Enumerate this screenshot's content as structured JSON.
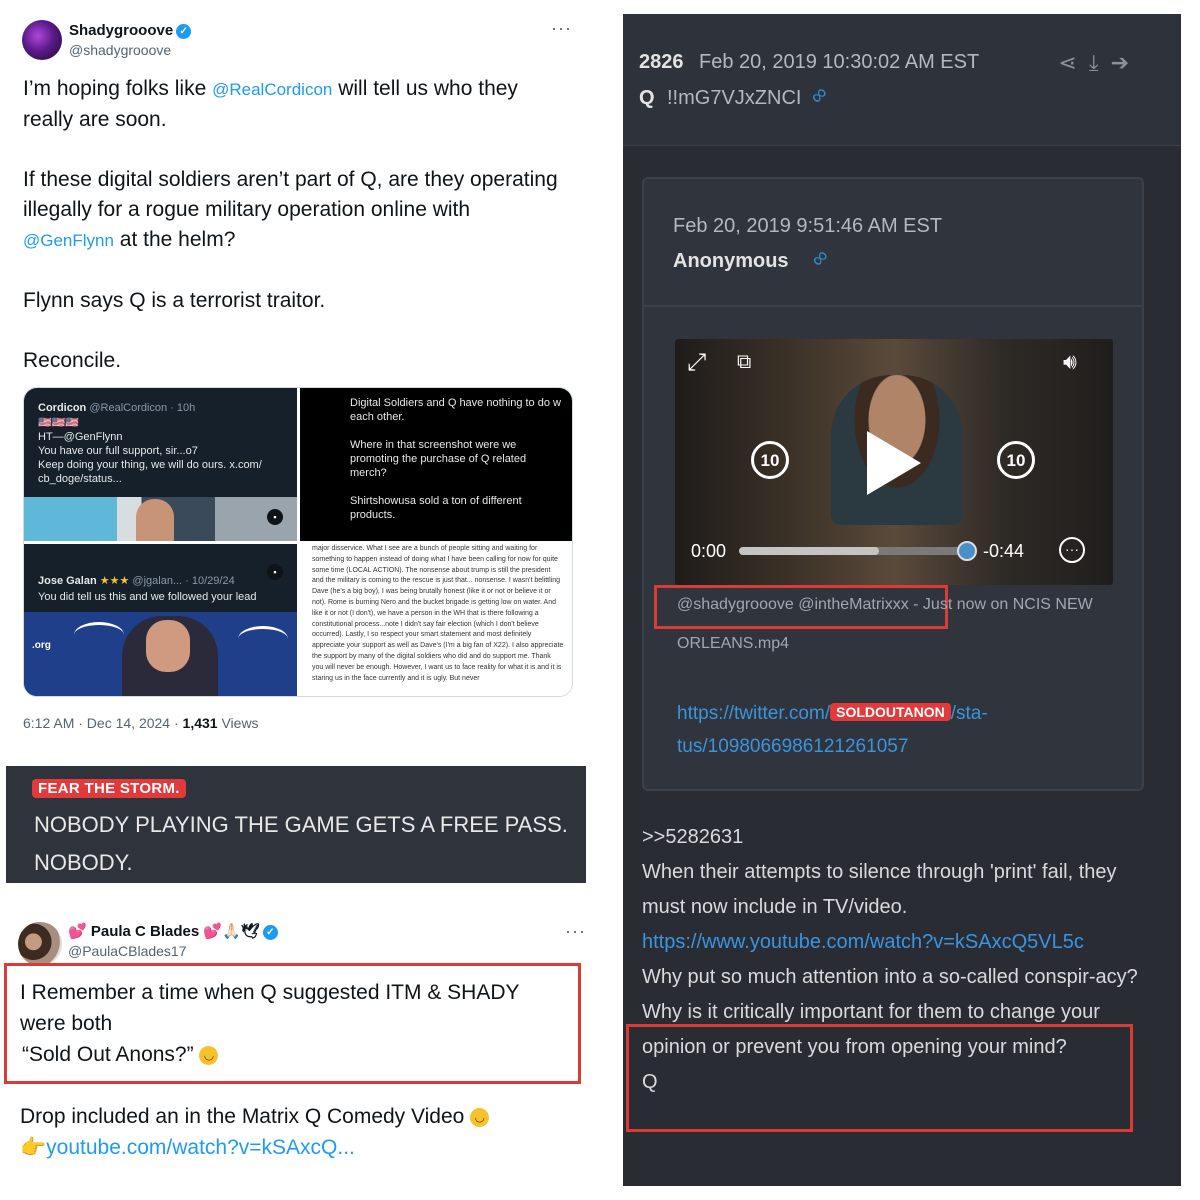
{
  "tweet1": {
    "name": "Shadygrooove",
    "handle": "@shadygrooove",
    "more": "···",
    "p1_pre": "I’m hoping folks like ",
    "p1_mention": "@RealCordicon",
    "p1_post": " will tell us who they really are soon.",
    "p2_pre": "If these digital soldiers aren’t part of Q, are they operating illegally for a rogue military operation online with ",
    "p2_mention": "@GenFlynn",
    "p2_post": " at the helm?",
    "p3": "Flynn says Q is a terrorist traitor.",
    "p4": "Reconcile.",
    "time": "6:12 AM · Dec 14, 2024 · ",
    "views_count": "1,431",
    "views_label": " Views",
    "media": {
      "tl_name": "Cordicon",
      "tl_handle": "@RealCordicon · 10h",
      "tl_flags": "🇺🇸🇺🇸🇺🇸",
      "tl_line1": "HT—@GenFlynn",
      "tl_line2": "You have our full support, sir...o7",
      "tl_line3": "Keep doing your thing, we will do ours. x.com/",
      "tl_line4": "cb_doge/status...",
      "tr_line1": "Digital Soldiers and Q have nothing to do w each other.",
      "tr_line2": "Where in that screenshot were we promoting the purchase of Q related merch?",
      "tr_line3": "Shirtshowusa sold a ton of different products.",
      "bl_name": "Jose Galan",
      "bl_stars": "★★★",
      "bl_handle": "@jgalan... · 10/29/24",
      "bl_line": "You did tell us this and we followed your lead",
      "bl_logo": ".org",
      "br_text": "major disservice. What I see are a bunch of people sitting and waiting for something to happen instead of doing what I have been calling for now for quite some time (LOCAL ACTION). The nonsense about trump is still the president and the military is coming to the rescue is just that... nonsense. I wasn't belittling Dave (he's a big boy), I was being brutally honest (like it or not or believe it or not). Rome is burning Nero and the bucket brigade is getting low on water. And like it or not (I don't), we have a person in the WH that is there following a constitutional process...note I didn't say fair election (which I don't believe occurred). Lastly, I so respect your smart statement and most definitely appreciate your support as well as Dave's (I'm a big fan of X22). I also appreciate the support by many of the digital soldiers who did and do support me. Thank you will never be enough. However, I want us to face reality for what it is and it is staring us in the face currently and it is ugly. But never"
    }
  },
  "banner": {
    "tag": "FEAR THE STORM.",
    "line1": "NOBODY PLAYING THE GAME GETS A FREE PASS.",
    "line2": "NOBODY."
  },
  "tweet2": {
    "name": "Paula C Blades",
    "name_prefix": "💕",
    "name_suffix": "💕🙏🏻🕊",
    "handle": "@PaulaCBlades17",
    "more": "···",
    "line1": "I Remember a time when Q suggested ITM & SHADY were both",
    "line2": "“Sold Out Anons?”",
    "line3": "Drop included an in the Matrix Q Comedy Video",
    "link_prefix": "👉",
    "link": "youtube.com/watch?v=kSAxcQ..."
  },
  "qdrop": {
    "number": "2826",
    "date": "Feb 20, 2019 10:30:02 AM EST",
    "q_label": "Q",
    "tripcode": "!!mG7VJxZNCI",
    "actions": "⤴⤓➜",
    "quote": {
      "date": "Feb 20, 2019 9:51:46 AM EST",
      "name": "Anonymous",
      "video": {
        "time_elapsed": "0:00",
        "time_remaining": "-0:44",
        "skip_back": "10",
        "skip_fwd": "10",
        "progress": 0.61
      },
      "caption_handles": "@shadygrooove @intheMatrixxx",
      "caption_rest": " - Just now on NCIS NEW",
      "caption_line2": "ORLEANS.mp4",
      "twitter_link_pre": "https://twitter.com/",
      "twitter_link_redacted": "SOLDOUTANON",
      "twitter_link_post": "/sta-",
      "twitter_link_line2": "tus/1098066986121261057"
    },
    "body": {
      "reply_ref": ">>5282631",
      "line1": "When their attempts to silence through 'print' fail, they must now include in TV/video.",
      "youtube": "https://www.youtube.com/watch?v=kSAxcQ5VL5c",
      "line2": "Why put so much attention into a so-called conspir-acy?",
      "line3": "Why is it critically important for them to change your opinion or prevent you from opening your mind?",
      "signoff": "Q"
    }
  },
  "colors": {
    "link_blue": "#1d9bf0",
    "highlight_red": "#d93b37",
    "qpanel_bg": "#292c33",
    "banner_bg": "#2f333b"
  }
}
